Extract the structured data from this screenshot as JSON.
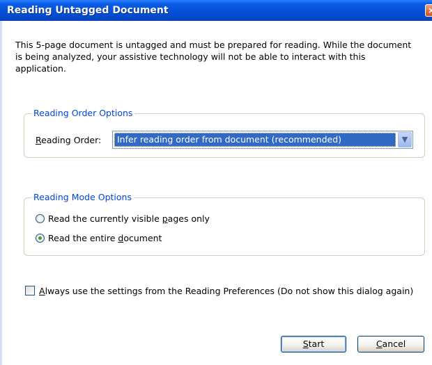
{
  "window": {
    "title": "Reading Untagged Document",
    "close_symbol": "×"
  },
  "description": "This 5-page document is untagged and must be prepared for reading. While the document is being analyzed, your assistive technology will not be able to interact with this application.",
  "reading_order_group": {
    "legend": "Reading Order Options",
    "field_label_first": "R",
    "field_label_rest": "eading Order:",
    "selected_value": "Infer reading order from document (recommended)"
  },
  "reading_mode_group": {
    "legend": "Reading Mode Options",
    "options": [
      {
        "before": "Read the currently visible ",
        "mnemonic": "p",
        "after": "ages only",
        "selected": false
      },
      {
        "before": "Read the entire ",
        "mnemonic": "d",
        "after": "ocument",
        "selected": true
      }
    ]
  },
  "always_use_settings": {
    "mnemonic": "A",
    "label_rest": "lways use the settings from the Reading Preferences (Do not show this dialog again)",
    "checked": false
  },
  "buttons": {
    "start_mnemonic": "S",
    "start_rest": "tart",
    "cancel_mnemonic": "C",
    "cancel_rest": "ancel"
  },
  "icons": {
    "close": "close-icon",
    "dropdown": "chevron-down-icon",
    "radio_selected": "radio-selected-icon",
    "radio_unselected": "radio-unselected-icon",
    "checkbox_unchecked": "checkbox-unchecked-icon"
  },
  "colors": {
    "titlebar": "#0550d6",
    "group_legend": "#0046d5",
    "selection": "#316ac5",
    "radio_dot": "#2fa62f"
  }
}
